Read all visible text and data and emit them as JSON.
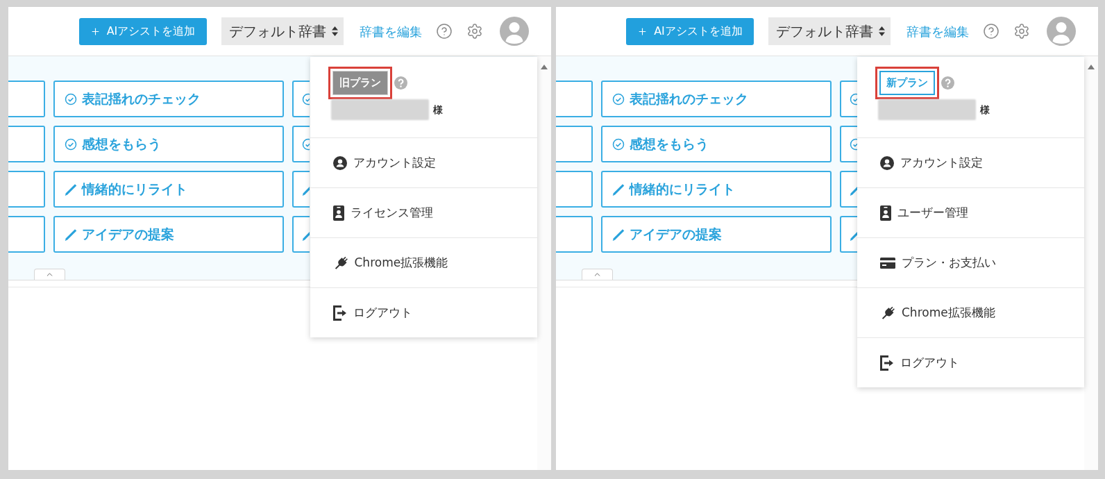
{
  "panels": [
    {
      "top_bar": {
        "add_button": "AIアシストを追加",
        "dictionary_select": "デフォルト辞書",
        "edit_link": "辞書を編集"
      },
      "assist_rows": [
        {
          "buttons": [
            {
              "kind": "check",
              "label": "表記揺れのチェック"
            },
            {
              "kind": "check"
            }
          ]
        },
        {
          "buttons": [
            {
              "kind": "check",
              "label": "感想をもらう"
            },
            {
              "kind": "check"
            }
          ]
        },
        {
          "buttons": [
            {
              "kind": "rewrite",
              "label": "情緒的にリライト"
            },
            {
              "kind": "rewrite"
            }
          ]
        },
        {
          "buttons": [
            {
              "kind": "rewrite",
              "label": "アイデアの提案"
            },
            {
              "kind": "rewrite"
            }
          ]
        }
      ],
      "account_menu": {
        "plan_badge": {
          "kind": "old",
          "label": "旧プラン",
          "highlighted": true
        },
        "honorific": "様",
        "items": [
          {
            "kind": "account",
            "label": "アカウント設定"
          },
          {
            "kind": "badge",
            "label": "ライセンス管理"
          },
          {
            "kind": "plug",
            "label": "Chrome拡張機能"
          },
          {
            "kind": "exit",
            "label": "ログアウト"
          }
        ]
      }
    },
    {
      "top_bar": {
        "add_button": "AIアシストを追加",
        "dictionary_select": "デフォルト辞書",
        "edit_link": "辞書を編集"
      },
      "assist_rows": [
        {
          "buttons": [
            {
              "kind": "check",
              "label": "表記揺れのチェック"
            },
            {
              "kind": "check"
            }
          ]
        },
        {
          "buttons": [
            {
              "kind": "check",
              "label": "感想をもらう"
            },
            {
              "kind": "check"
            }
          ]
        },
        {
          "buttons": [
            {
              "kind": "rewrite",
              "label": "情緒的にリライト"
            },
            {
              "kind": "rewrite"
            }
          ]
        },
        {
          "buttons": [
            {
              "kind": "rewrite",
              "label": "アイデアの提案"
            },
            {
              "kind": "rewrite"
            }
          ]
        }
      ],
      "account_menu": {
        "plan_badge": {
          "kind": "new",
          "label": "新プラン",
          "highlighted": true
        },
        "honorific": "様",
        "items": [
          {
            "kind": "account",
            "label": "アカウント設定"
          },
          {
            "kind": "badge",
            "label": "ユーザー管理"
          },
          {
            "kind": "card",
            "label": "プラン・お支払い"
          },
          {
            "kind": "plug",
            "label": "Chrome拡張機能"
          },
          {
            "kind": "exit",
            "label": "ログアウト"
          }
        ]
      }
    }
  ]
}
